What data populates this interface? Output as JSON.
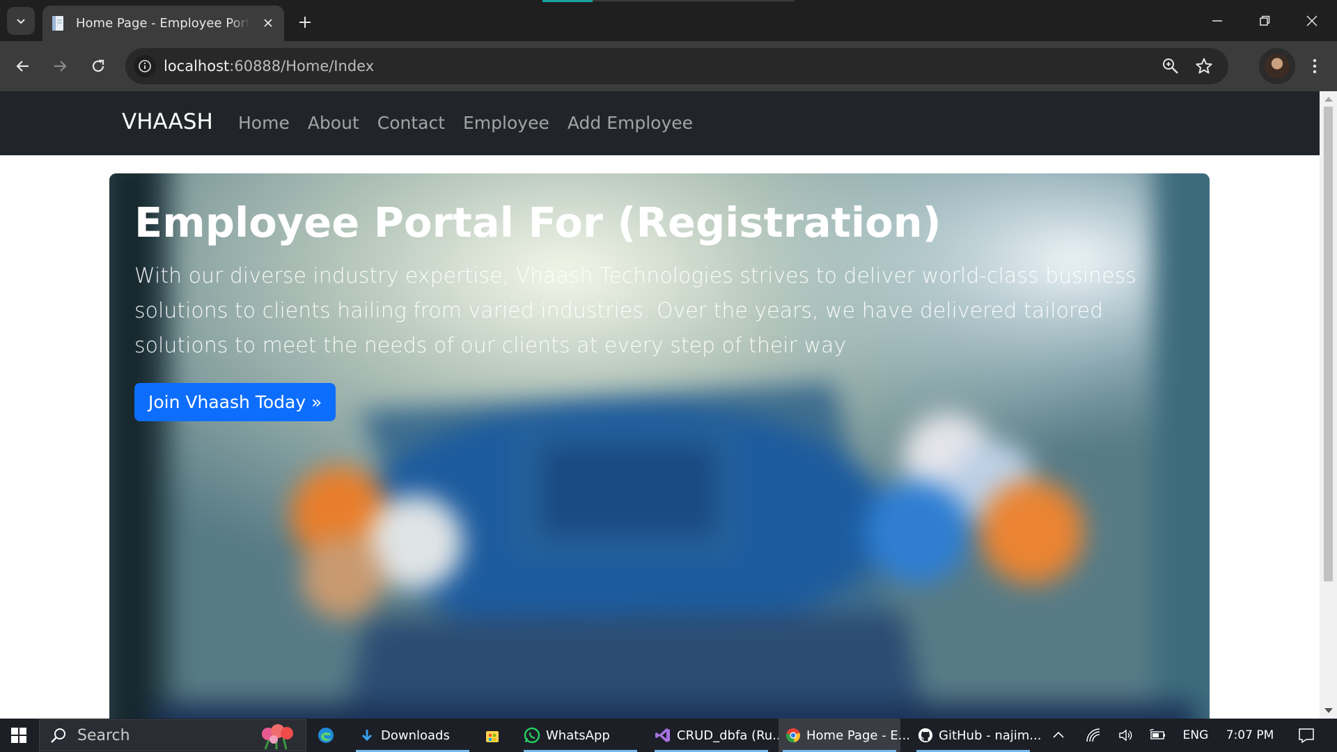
{
  "browser": {
    "tab_title": "Home Page - Employee Portal For (Registration)",
    "address": {
      "host": "localhost",
      "rest": ":60888/Home/Index"
    }
  },
  "site": {
    "brand": "VHAASH",
    "nav": [
      "Home",
      "About",
      "Contact",
      "Employee",
      "Add Employee"
    ],
    "hero": {
      "title": "Employee Portal For (Registration)",
      "text": "With our diverse industry expertise, Vhaash Technologies strives to deliver world-class business solutions to clients hailing from varied industries. Over the years, we have delivered tailored solutions to meet the needs of our clients at every step of their way",
      "button": "Join Vhaash Today »"
    }
  },
  "taskbar": {
    "search_label": "Search",
    "apps": [
      {
        "label": "Downloads",
        "icon": "download-arrow-icon"
      },
      {
        "label": "WhatsApp",
        "icon": "whatsapp-icon"
      },
      {
        "label": "CRUD_dbfa (Ru...",
        "icon": "visual-studio-icon"
      },
      {
        "label": "Home Page - E...",
        "icon": "chrome-icon"
      },
      {
        "label": "GitHub - najim...",
        "icon": "github-icon"
      }
    ],
    "tray": {
      "language": "ENG",
      "time": "7:07 PM"
    }
  },
  "colors": {
    "primary_button": "#0d6efd",
    "navbar": "#212529",
    "chrome_tab": "#3c3c3c"
  }
}
